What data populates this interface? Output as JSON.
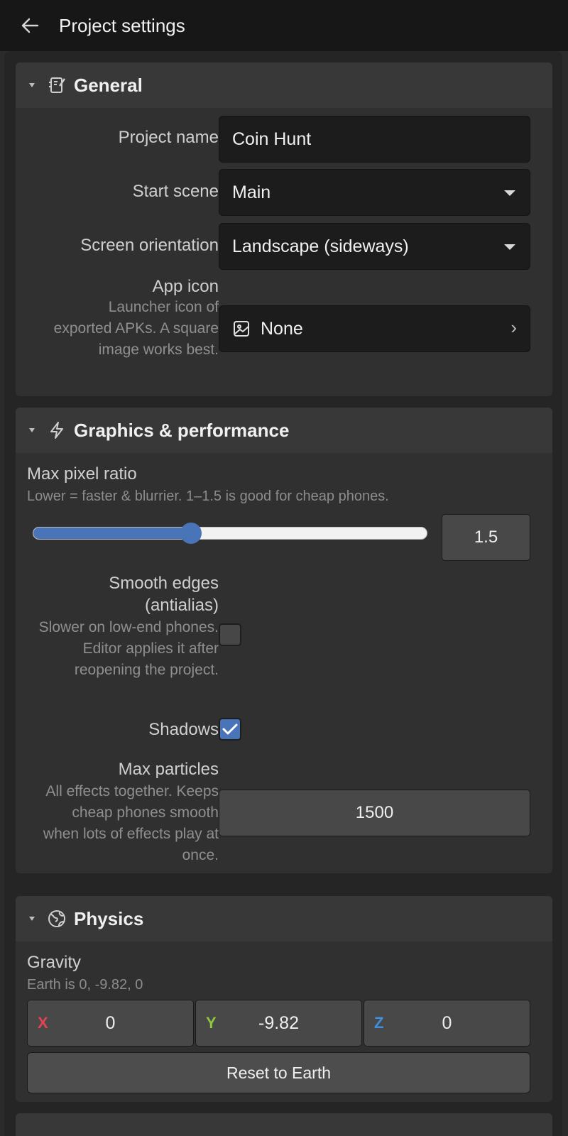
{
  "header": {
    "title": "Project settings",
    "back_icon": "arrow-left-icon"
  },
  "general": {
    "title": "General",
    "icon": "edit-icon",
    "project_name": {
      "label": "Project name",
      "value": "Coin Hunt"
    },
    "start_scene": {
      "label": "Start scene",
      "value": "Main"
    },
    "orientation": {
      "label": "Screen orientation",
      "value": "Landscape (sideways)"
    },
    "app_icon": {
      "label": "App icon",
      "help": "Launcher icon of exported APKs. A square image works best.",
      "value": "None",
      "icon": "image-icon"
    }
  },
  "graphics": {
    "title": "Graphics & performance",
    "icon": "lightning-icon",
    "pixel_ratio": {
      "label": "Max pixel ratio",
      "help": "Lower = faster & blurrier. 1–1.5 is good for cheap phones.",
      "value": "1.5",
      "slider_fraction": 0.4
    },
    "antialias": {
      "label": "Smooth edges (antialias)",
      "help": "Slower on low-end phones. Editor applies it after reopening the project.",
      "checked": false
    },
    "shadows": {
      "label": "Shadows",
      "checked": true
    },
    "particles": {
      "label": "Max particles",
      "help": "All effects together. Keeps cheap phones smooth when lots of effects play at once.",
      "value": "1500"
    }
  },
  "physics": {
    "title": "Physics",
    "icon": "globe-icon",
    "gravity": {
      "label": "Gravity",
      "help": "Earth is 0, -9.82, 0",
      "x_label": "X",
      "x": "0",
      "y_label": "Y",
      "y": "-9.82",
      "z_label": "Z",
      "z": "0"
    },
    "reset_label": "Reset to Earth"
  },
  "colors": {
    "accent": "#4a74b8",
    "axis_x": "#e0454f",
    "axis_y": "#8dc63f",
    "axis_z": "#3f8fe0"
  }
}
